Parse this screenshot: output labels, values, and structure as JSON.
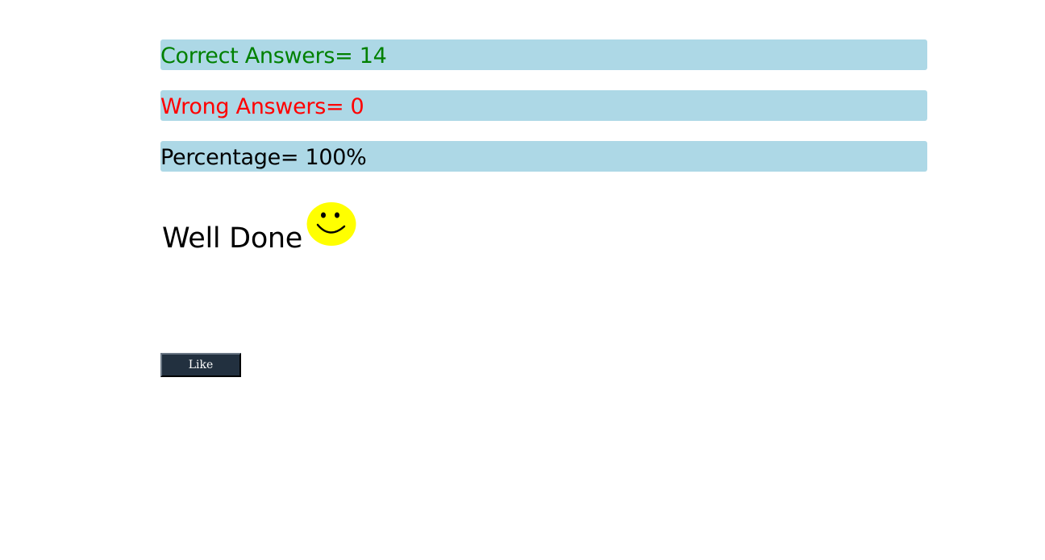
{
  "results": {
    "correct_label": "Correct Answers= 14",
    "wrong_label": "Wrong Answers= 0",
    "percentage_label": "Percentage= 100%"
  },
  "message": {
    "text": "Well Done",
    "icon": "smiley-icon"
  },
  "like_button": {
    "label": "Like"
  },
  "colors": {
    "bar_background": "#add8e6",
    "correct_text": "#008000",
    "wrong_text": "#ff0000",
    "percentage_text": "#000000",
    "smiley_face": "#ffff00",
    "button_background": "#22303f"
  }
}
